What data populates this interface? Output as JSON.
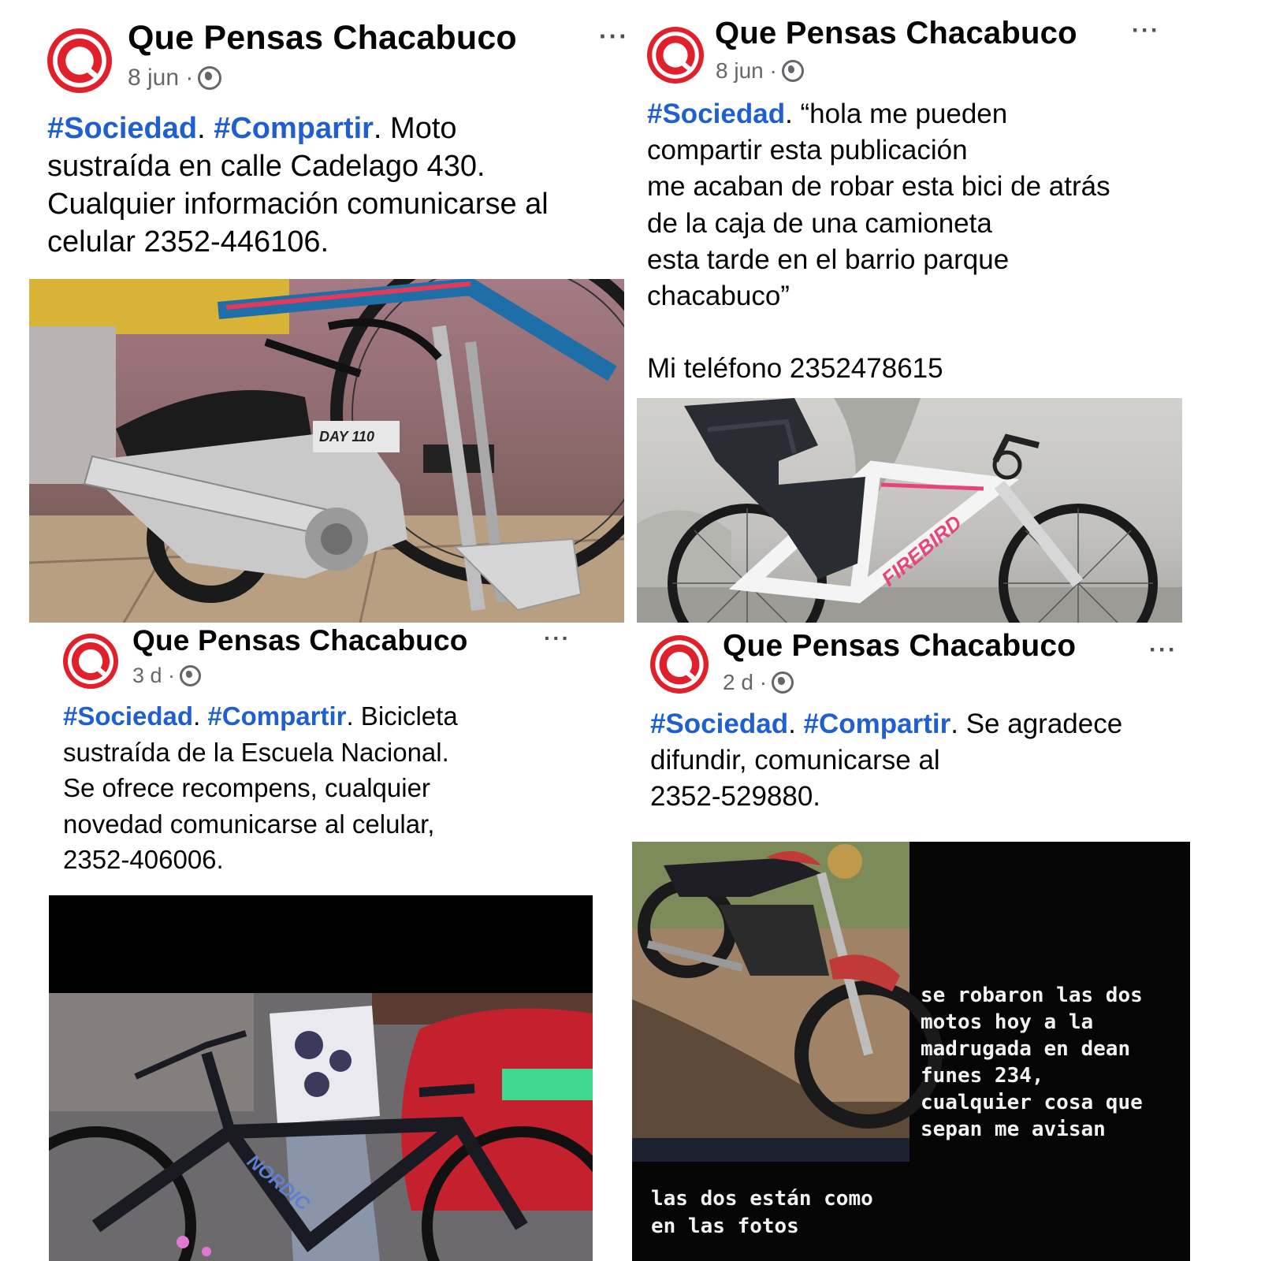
{
  "posts": [
    {
      "page_name": "Que Pensas Chacabuco",
      "date": "8 jun ·",
      "more": "···",
      "tags": [
        "#Sociedad",
        "#Compartir"
      ],
      "text_lines": [
        ". Moto",
        "sustraída en calle Cadelago 430.",
        "Cualquier información comunicarse al",
        "celular 2352-446106."
      ],
      "photo_icon": "motorcycle-photo"
    },
    {
      "page_name": "Que Pensas Chacabuco",
      "date": "8 jun ·",
      "more": "···",
      "tags": [
        "#Sociedad"
      ],
      "text_lines": [
        ". “hola me pueden",
        "compartir esta publicación",
        "me acaban de robar esta bici de atrás",
        "de la caja de una camioneta",
        "esta tarde en el barrio parque",
        "chacabuco”",
        "",
        "Mi teléfono 2352478615"
      ],
      "photo_icon": "bicycle-photo",
      "photo_brand_text": "FIREBIRD"
    },
    {
      "page_name": "Que Pensas Chacabuco",
      "date": "3 d ·",
      "more": "···",
      "tags": [
        "#Sociedad",
        "#Compartir"
      ],
      "text_lines": [
        ". Bicicleta",
        "sustraída de la Escuela Nacional.",
        "Se ofrece recompens, cualquier",
        "novedad comunicarse al celular,",
        "2352-406006."
      ],
      "photo_icon": "bicycle-photo",
      "photo_brand_text": "NORDIC"
    },
    {
      "page_name": "Que Pensas Chacabuco",
      "date": "2 d ·",
      "more": "···",
      "tags": [
        "#Sociedad",
        "#Compartir"
      ],
      "text_lines": [
        ". Se agradece",
        "difundir, comunicarse al",
        "2352-529880."
      ],
      "photo_icon": "motorcycle-photo",
      "overlay_lines": [
        "se robaron las dos",
        "motos hoy a la",
        "madrugada en dean",
        "funes 234,",
        "cualquier cosa que",
        "sepan me avisan"
      ],
      "overlay_bottom_lines": [
        "las dos están como",
        "en las fotos"
      ]
    }
  ],
  "colors": {
    "hashtag": "#1f5fd1",
    "meta_gray": "#65676b",
    "logo_red": "#e0202a",
    "logo_blue": "#1f5fc4"
  }
}
